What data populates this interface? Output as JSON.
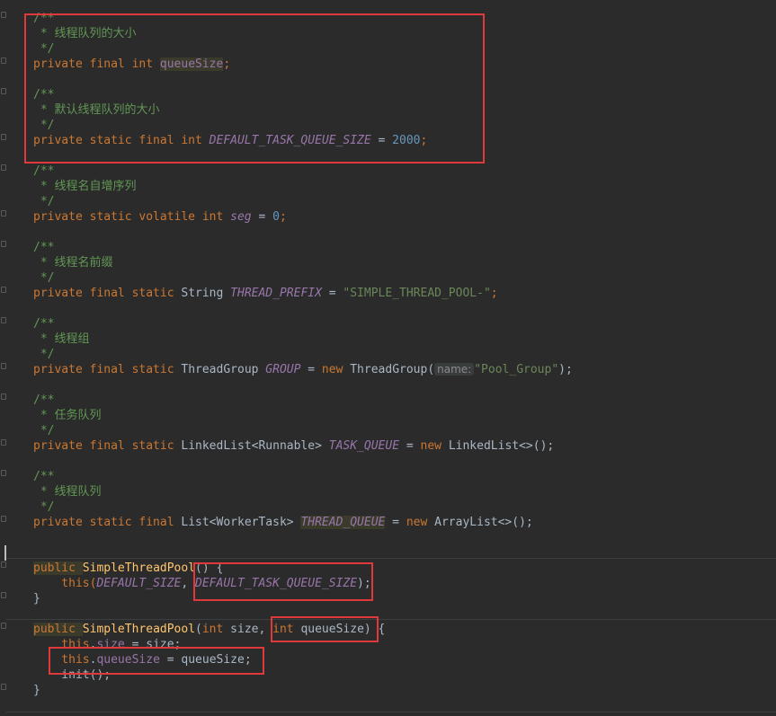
{
  "code": {
    "l1_comment_open": "/**",
    "l1_comment_text": " * 线程队列的大小",
    "l1_comment_close": " */",
    "l1_kw": "private final int ",
    "l1_field": "queueSize",
    "l1_end": ";",
    "l2_comment_open": "/**",
    "l2_comment_text": " * 默认线程队列的大小",
    "l2_comment_close": " */",
    "l2_kw": "private static final int ",
    "l2_field": "DEFAULT_TASK_QUEUE_SIZE",
    "l2_eq": " = ",
    "l2_num": "2000",
    "l2_end": ";",
    "l3_comment_open": "/**",
    "l3_comment_text": " * 线程名自增序列",
    "l3_comment_close": " */",
    "l3_kw": "private static volatile int ",
    "l3_field": "seg",
    "l3_eq": " = ",
    "l3_num": "0",
    "l3_end": ";",
    "l4_comment_open": "/**",
    "l4_comment_text": " * 线程名前缀",
    "l4_comment_close": " */",
    "l4_kw": "private final static ",
    "l4_type": "String ",
    "l4_field": "THREAD_PREFIX",
    "l4_eq": " = ",
    "l4_str": "\"SIMPLE_THREAD_POOL-\"",
    "l4_end": ";",
    "l5_comment_open": "/**",
    "l5_comment_text": " * 线程组",
    "l5_comment_close": " */",
    "l5_kw": "private final static ",
    "l5_type": "ThreadGroup ",
    "l5_field": "GROUP",
    "l5_eq": " = ",
    "l5_new": "new ",
    "l5_ctor": "ThreadGroup(",
    "l5_hint": "name:",
    "l5_str": "\"Pool_Group\"",
    "l5_end": ");",
    "l6_comment_open": "/**",
    "l6_comment_text": " * 任务队列",
    "l6_comment_close": " */",
    "l6_kw": "private final static ",
    "l6_type": "LinkedList<Runnable> ",
    "l6_field": "TASK_QUEUE",
    "l6_eq": " = ",
    "l6_new": "new ",
    "l6_ctor": "LinkedList<>();",
    "l7_comment_open": "/**",
    "l7_comment_text": " * 线程队列",
    "l7_comment_close": " */",
    "l7_kw": "private static final ",
    "l7_type": "List<WorkerTask> ",
    "l7_field": "THREAD_QUEUE",
    "l7_eq": " = ",
    "l7_new": "new ",
    "l7_ctor": "ArrayList<>();",
    "c1_public": "public ",
    "c1_name": "SimpleThreadPool",
    "c1_rest": "() {",
    "c1_this": "    this(",
    "c1_arg1": "DEFAULT_SIZE",
    "c1_comma": ", ",
    "c1_arg2": "DEFAULT_TASK_QUEUE_SIZE",
    "c1_end": ");",
    "c1_close": "}",
    "c2_public": "public ",
    "c2_name": "SimpleThreadPool",
    "c2_open": "(",
    "c2_int1": "int ",
    "c2_p1": "size, ",
    "c2_int2": "int ",
    "c2_p2": "queueSize",
    "c2_rest": ") {",
    "c2_l1_this": "    this",
    "c2_l1_dot": ".",
    "c2_l1_field": "size",
    "c2_l1_rest": " = size;",
    "c2_l2_this": "    this",
    "c2_l2_dot": ".",
    "c2_l2_field": "queueSize",
    "c2_l2_rest": " = queueSize;",
    "c2_l3": "    init();",
    "c2_close": "}"
  }
}
